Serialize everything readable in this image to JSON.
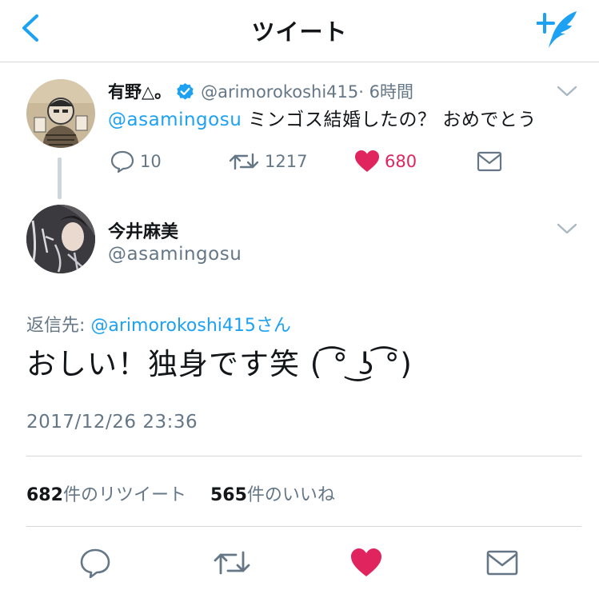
{
  "nav": {
    "title": "ツイート",
    "back_icon": "chevron-left-icon",
    "compose_icon": "compose-tweet-icon",
    "accent": "#1da1f2"
  },
  "parent_tweet": {
    "display_name": "有野△。",
    "verified": true,
    "handle": "@arimorokoshi415",
    "time": "· 6時間",
    "mention": "@asamingosu",
    "text": " ミンゴス結婚したの？ おめでとう",
    "replies": "10",
    "retweets": "1217",
    "likes": "680"
  },
  "reply_tweet": {
    "display_name": "今井麻美",
    "handle": "@asamingosu",
    "replying_to_label": "返信先: ",
    "replying_to_handle": "@arimorokoshi415さん",
    "text": "おしい！独身です笑 ( ͡° ͜ʖ ͡°)",
    "timestamp": "2017/12/26 23:36",
    "retweet_count": "682",
    "retweet_label": "件のリツイート",
    "like_count": "565",
    "like_label": "件のいいね"
  },
  "colors": {
    "like": "#e0245e",
    "secondary_text": "#657786",
    "divider": "#d8d8d8"
  }
}
